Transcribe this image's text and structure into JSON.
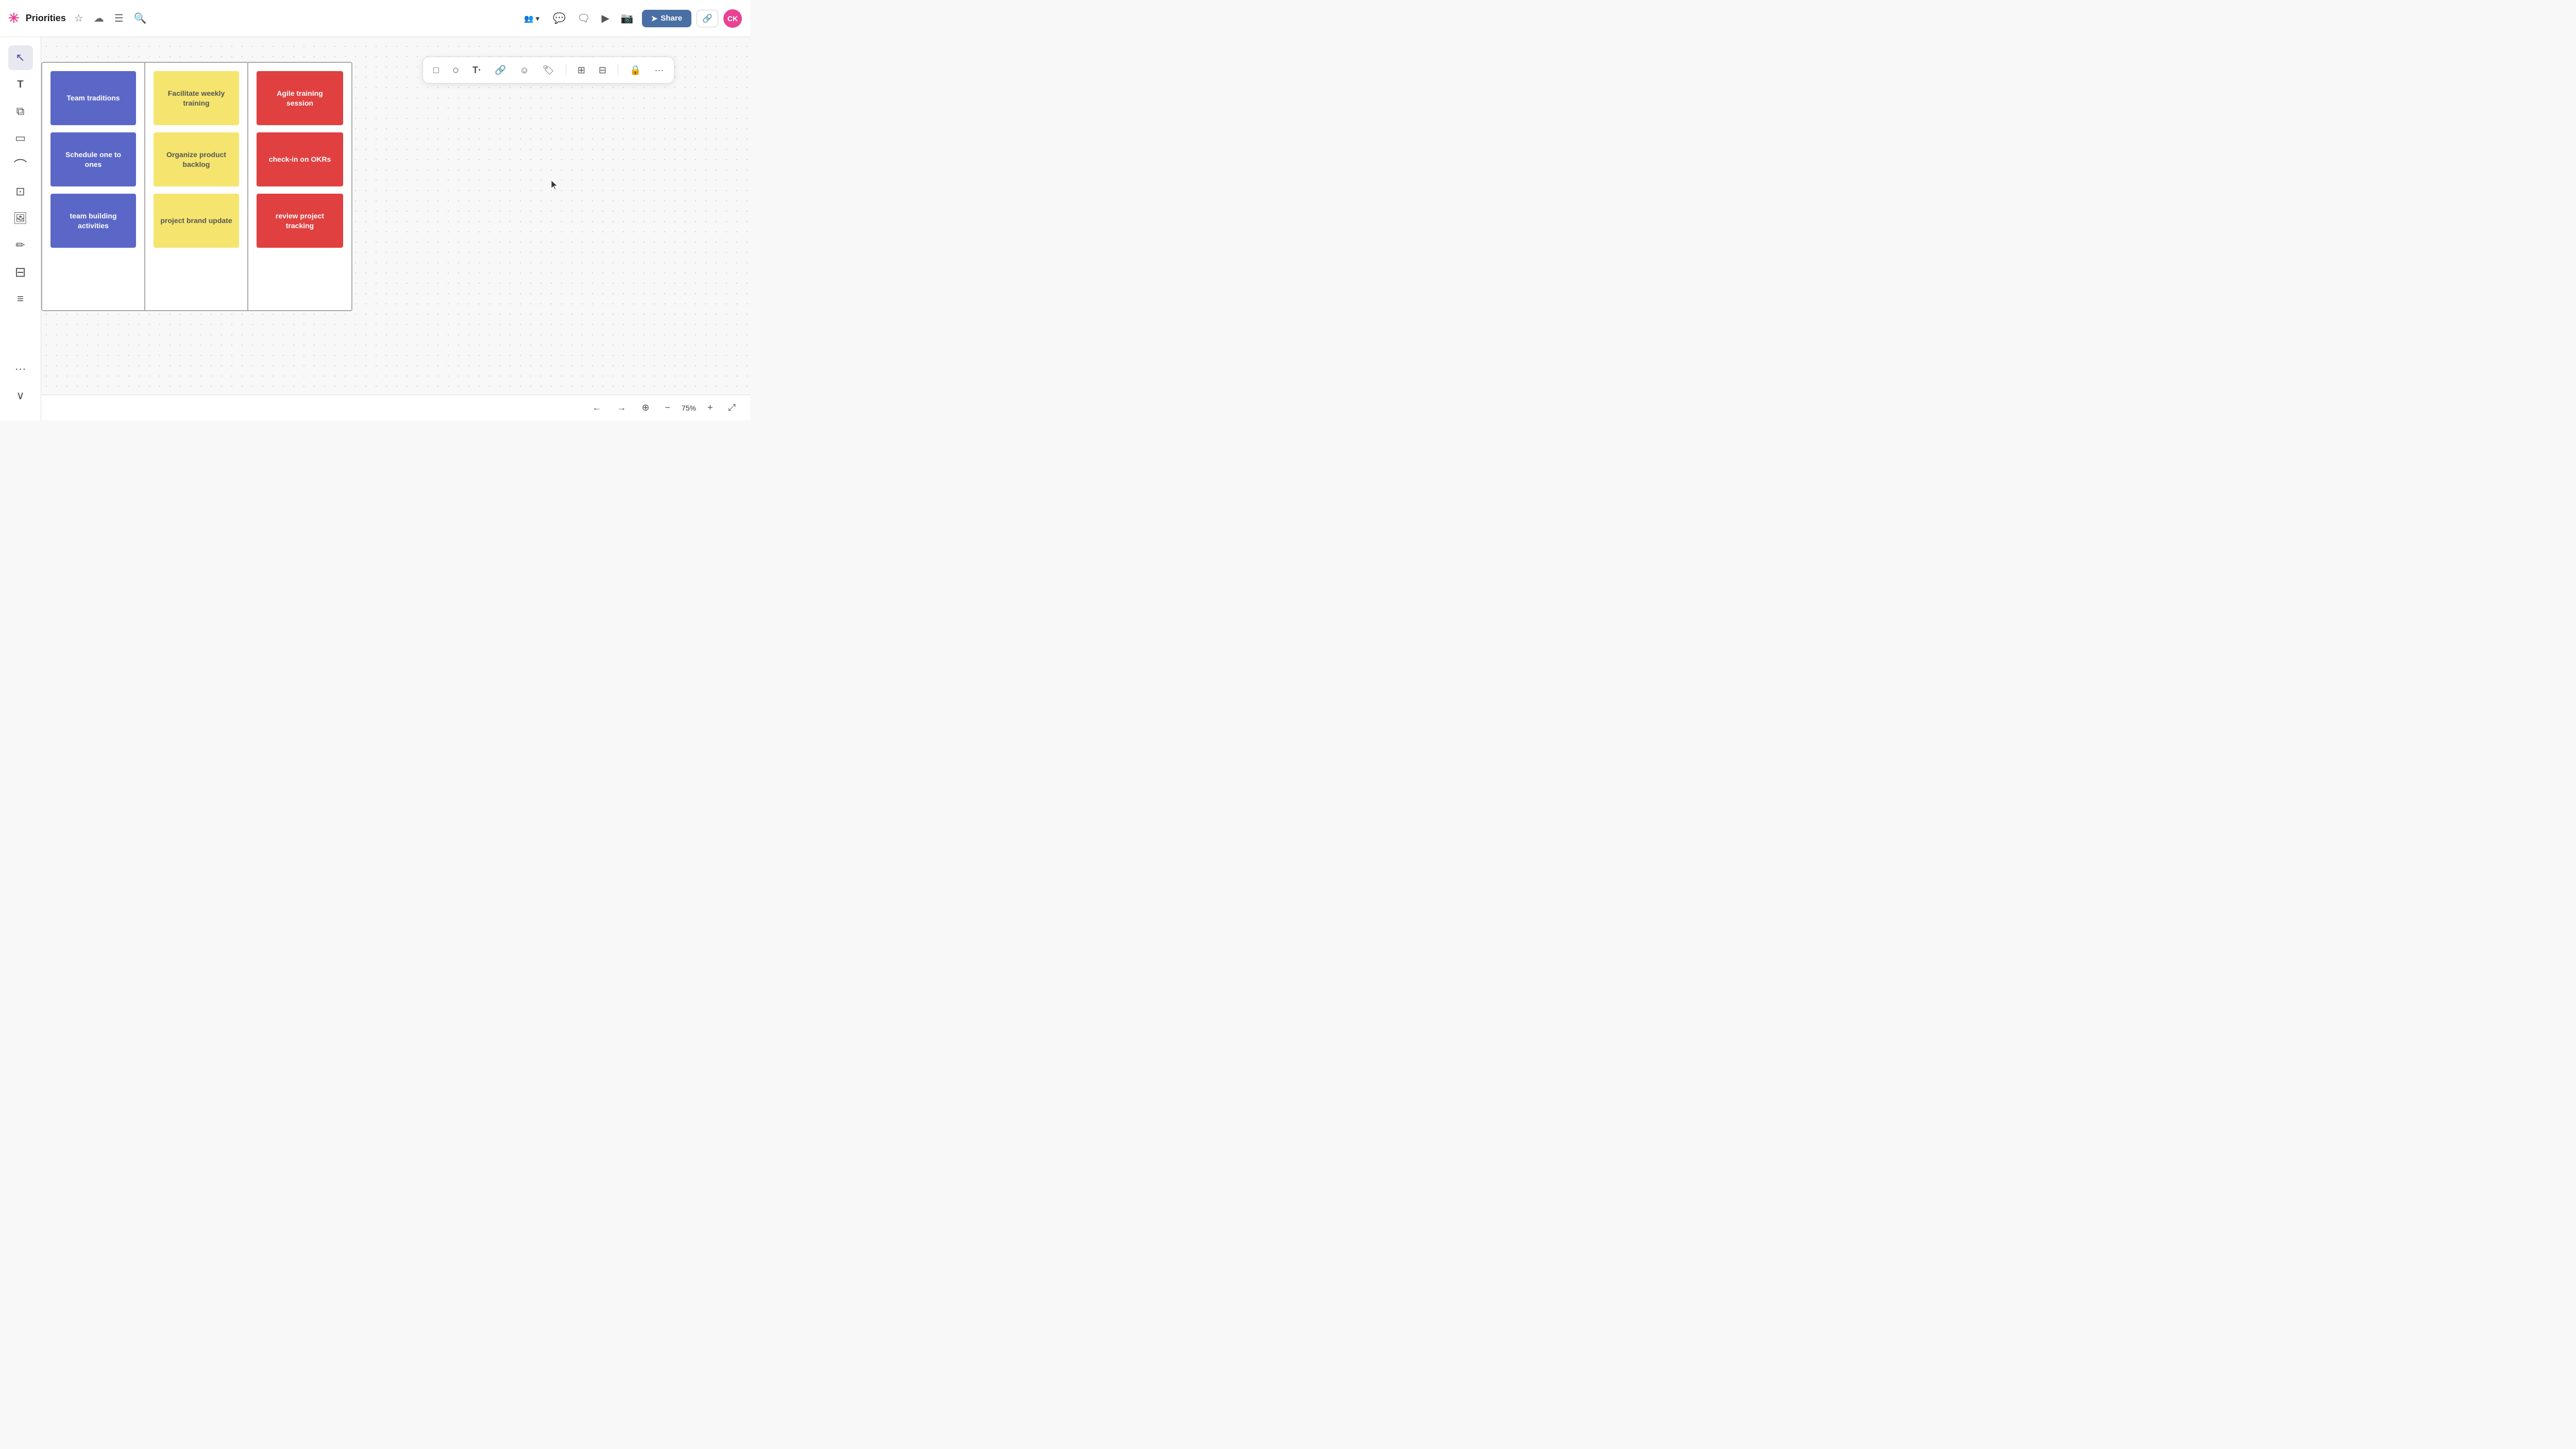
{
  "header": {
    "logo": "✳",
    "title": "Priorities",
    "star_icon": "☆",
    "history_icon": "☁",
    "menu_icon": "☰",
    "search_icon": "🔍",
    "share_label": "Share",
    "avatar_label": "CK",
    "team_dropdown": "👥",
    "chat_icon": "💬",
    "comment_icon": "🗨",
    "video_icon": "▶",
    "camera_icon": "📷",
    "link_icon": "🔗"
  },
  "toolbar": {
    "square_icon": "□",
    "circle_icon": "○",
    "text_icon": "T·",
    "link_icon": "🔗",
    "emoji_icon": "☺",
    "tag_icon": "🏷",
    "grid1_icon": "⊞",
    "grid2_icon": "⊟",
    "lock_icon": "🔒",
    "more_icon": "···"
  },
  "sidebar": {
    "items": [
      {
        "icon": "↖",
        "name": "select-tool",
        "active": true
      },
      {
        "icon": "T",
        "name": "text-tool",
        "active": false
      },
      {
        "icon": "⧉",
        "name": "frame-tool",
        "active": false
      },
      {
        "icon": "□",
        "name": "rectangle-tool",
        "active": false
      },
      {
        "icon": "⌒",
        "name": "line-tool",
        "active": false
      },
      {
        "icon": "⊡",
        "name": "crop-tool",
        "active": false
      },
      {
        "icon": "🖼",
        "name": "image-tool",
        "active": false
      },
      {
        "icon": "✏",
        "name": "draw-tool",
        "active": false
      },
      {
        "icon": "≡",
        "name": "table-tool",
        "active": false
      },
      {
        "icon": "≡",
        "name": "list-tool",
        "active": false
      }
    ],
    "bottom_items": [
      {
        "icon": "⊕",
        "name": "add-tool"
      },
      {
        "icon": "···",
        "name": "more-tools"
      },
      {
        "icon": "∨",
        "name": "collapse"
      }
    ]
  },
  "board": {
    "columns": [
      {
        "id": "col1",
        "cards": [
          {
            "id": "card1",
            "text": "Team traditions",
            "color": "blue"
          },
          {
            "id": "card2",
            "text": "Schedule one to ones",
            "color": "blue"
          },
          {
            "id": "card3",
            "text": "team building activities",
            "color": "blue"
          }
        ]
      },
      {
        "id": "col2",
        "cards": [
          {
            "id": "card4",
            "text": "Facilitate weekly training",
            "color": "yellow"
          },
          {
            "id": "card5",
            "text": "Organize product backlog",
            "color": "yellow"
          },
          {
            "id": "card6",
            "text": "project brand update",
            "color": "yellow"
          }
        ]
      },
      {
        "id": "col3",
        "cards": [
          {
            "id": "card7",
            "text": "Agile training session",
            "color": "red"
          },
          {
            "id": "card8",
            "text": "check-in on OKRs",
            "color": "red"
          },
          {
            "id": "card9",
            "text": "review project tracking",
            "color": "red"
          }
        ]
      }
    ]
  },
  "zoom": {
    "level": "75%",
    "undo_icon": "←",
    "redo_icon": "→",
    "home_icon": "⊕",
    "minus_icon": "−",
    "plus_icon": "+",
    "fullscreen_icon": "⤢"
  }
}
